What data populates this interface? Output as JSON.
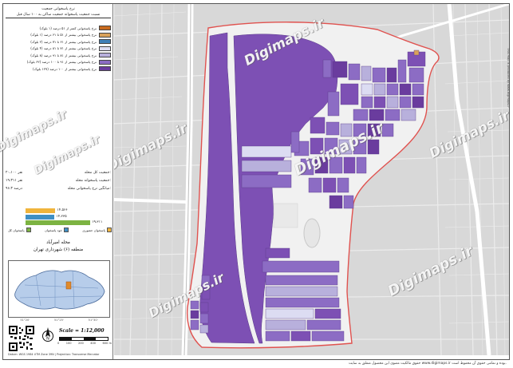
{
  "title": {
    "line1": "نرخ پاسخوانی جمعیت",
    "line2": "نسبت جمعیت پاسخوانه جمعیت ساکن به ۱۰۰ سال قبل"
  },
  "legend": [
    {
      "label": "نرخ پاسخوانی کمتر از ۵۱ درصد (۱ بلوک)",
      "color": "#c86a1e"
    },
    {
      "label": "نرخ پاسخوانی بیشتر از ۵۱ تا ۶۱ درصد (۱ بلوک)",
      "color": "#d9a25a"
    },
    {
      "label": "نرخ پاسخوانی بیشتر از ۶۱ تا ۷۱ درصد (۲ بلوک)",
      "color": "#3f7fb8"
    },
    {
      "label": "نرخ پاسخوانی بیشتر از ۷۱ تا ۸۱ درصد (۴ بلوک)",
      "color": "#dcdcf2"
    },
    {
      "label": "نرخ پاسخوانی بیشتر از ۸۱ تا ۹۱ درصد (۸ بلوک)",
      "color": "#b8b0dc"
    },
    {
      "label": "نرخ پاسخوانی بیشتر از ۹۱ تا ۱۰۰ درصد (۶۲ بلوک)",
      "color": "#8c6cc4"
    },
    {
      "label": "نرخ پاسخوانی بیشتر از ۱۰۰ درصد (۱۲۷ بلوک)",
      "color": "#6a3c9e"
    }
  ],
  "stats": [
    {
      "label": "جمعیت کل محله:",
      "value": "۲۰،۱۰۰ نفر"
    },
    {
      "label": "جمعیت پاسخوانه محله:",
      "value": "۱۹،۳۱۱ نفر"
    },
    {
      "label": "میانگین نرخ پاسخوانی محله:",
      "value": "۹۶،۳ درصد"
    }
  ],
  "bars": [
    {
      "text": "۱۴،۵۶۶",
      "fraction": 0.36,
      "color": "#f0b43c"
    },
    {
      "text": "۱۴،۲۳۵",
      "fraction": 0.35,
      "color": "#3f8fc4"
    },
    {
      "text": "۱۹،۳۱۱",
      "fraction": 0.78,
      "color": "#7cb342"
    }
  ],
  "bar_legend": [
    {
      "label": "پاسخوان کل",
      "color": "#7cb342"
    },
    {
      "label": "خود پاسخوان",
      "color": "#3f8fc4"
    },
    {
      "label": "پاسخوان حضوری",
      "color": "#f0b43c"
    }
  ],
  "place": {
    "name": "محله امیرآباد",
    "district": "منطقه (۶) شهرداری تهران"
  },
  "inset_axes": [
    "51°20'",
    "51°25'",
    "51°30'"
  ],
  "scale": {
    "label": "Scale = 1:12,000",
    "ticks": [
      "0",
      "100",
      "200",
      "400",
      "600 m"
    ]
  },
  "credit": "Datum: WGS 1984 UTM Zone 39N | Projection: Transverse Mercator",
  "watermark": "Digimaps.ir",
  "footer": "حقوق مالکیت معنوی این محصول متعلق به سایت www.digimaps.ir بوده و تمامی حقوق آن محفوظ است.",
  "side_note": "This map is produced by www.digimaps.ir"
}
